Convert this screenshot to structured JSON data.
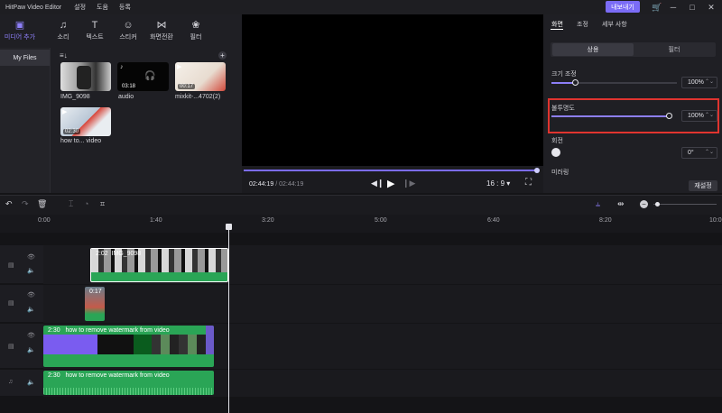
{
  "app": {
    "title": "HitPaw Video Editor",
    "menu": [
      "설정",
      "도움",
      "등록"
    ],
    "export_label": "내보내기"
  },
  "media_tabs": [
    {
      "label": "미디어 추가",
      "icon": "media-icon"
    },
    {
      "label": "소리",
      "icon": "music-icon"
    },
    {
      "label": "텍스트",
      "icon": "text-icon"
    },
    {
      "label": "스티커",
      "icon": "sticker-icon"
    },
    {
      "label": "화면전환",
      "icon": "transition-icon"
    },
    {
      "label": "필터",
      "icon": "filter-icon"
    }
  ],
  "sidebar": {
    "my_files": "My Files"
  },
  "media_items": [
    {
      "name": "IMG_9098",
      "duration": ""
    },
    {
      "name": "audio",
      "duration": "03:18"
    },
    {
      "name": "mixkit-...4702(2)",
      "duration": "00:17"
    },
    {
      "name": "how to... video",
      "duration": "02:30"
    }
  ],
  "preview": {
    "current_time": "02:44:19",
    "total_time": "02:44:19",
    "aspect": "16 : 9"
  },
  "right_panel": {
    "tabs": [
      "화면",
      "조정",
      "세부 사항"
    ],
    "segments": [
      "상용",
      "필터"
    ],
    "scale_label": "크기 조정",
    "scale_value": "100%",
    "opacity_label": "불투명도",
    "opacity_value": "100%",
    "rotate_label": "회전",
    "rotate_value": "0°",
    "mirror_label": "미러링",
    "reset_label": "재설정"
  },
  "timeline": {
    "ticks": [
      "0:00",
      "1:40",
      "3:20",
      "5:00",
      "6:40",
      "8:20",
      "10:0"
    ],
    "clips": {
      "img": {
        "duration": "2:02",
        "name": "IMG_9098"
      },
      "mixkit": {
        "duration": "0:17"
      },
      "video": {
        "duration": "2:30",
        "name": "how to remove watermark from video"
      },
      "audio": {
        "duration": "2:30",
        "name": "how to remove watermark from video"
      }
    }
  },
  "colors": {
    "accent": "#8d7ff8",
    "clip_green": "#2aa556",
    "clip_purple": "#7a5cf0",
    "highlight": "#e0342f"
  }
}
